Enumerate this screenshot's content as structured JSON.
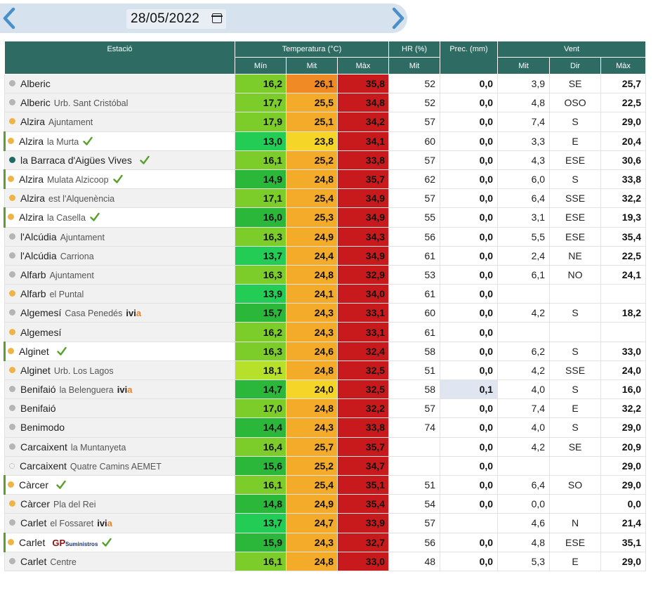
{
  "date": "28/05/2022",
  "colors": {
    "header_bg": "#2e6b63",
    "accent_arrow": "#4a90c8",
    "marker_green": "#5aa02c"
  },
  "headers": {
    "station": "Estació",
    "temperature": "Temperatura (°C)",
    "hr": "HR (%)",
    "prec": "Prec. (mm)",
    "wind": "Vent",
    "t_min": "Mín",
    "t_mit": "Mit",
    "t_max": "Màx",
    "hr_mit": "Mit",
    "w_mit": "Mit",
    "w_dir": "Dir",
    "w_max": "Màx"
  },
  "rows": [
    {
      "name": "Alberic",
      "sub": "",
      "dot": "#b5b5b5",
      "mark": false,
      "check": false,
      "logo": "",
      "tmin": "16,2",
      "tmit": "26,1",
      "tmax": "35,8",
      "cmin": "#7ccc2a",
      "cmit": "#f08a24",
      "cmax": "#c8191c",
      "hr": "52",
      "prec": "0,0",
      "wmit": "3,9",
      "wdir": "SE",
      "wmax": "25,7"
    },
    {
      "name": "Alberic",
      "sub": "Urb. Sant Cristóbal",
      "dot": "#b5b5b5",
      "mark": false,
      "check": false,
      "logo": "",
      "tmin": "17,7",
      "tmit": "25,5",
      "tmax": "34,8",
      "cmin": "#7ccc2a",
      "cmit": "#f5ab2a",
      "cmax": "#c8191c",
      "hr": "52",
      "prec": "0,0",
      "wmit": "4,8",
      "wdir": "OSO",
      "wmax": "22,5"
    },
    {
      "name": "Alzira",
      "sub": "Ajuntament",
      "dot": "#f0b445",
      "mark": false,
      "check": false,
      "logo": "",
      "tmin": "17,9",
      "tmit": "25,1",
      "tmax": "34,2",
      "cmin": "#7ccc2a",
      "cmit": "#f5ab2a",
      "cmax": "#c8191c",
      "hr": "57",
      "prec": "0,0",
      "wmit": "7,4",
      "wdir": "S",
      "wmax": "29,0"
    },
    {
      "name": "Alzira",
      "sub": "la Murta",
      "dot": "#f0b445",
      "mark": true,
      "check": true,
      "logo": "",
      "tmin": "13,0",
      "tmit": "23,8",
      "tmax": "34,1",
      "cmin": "#22cc55",
      "cmit": "#f5d528",
      "cmax": "#c8191c",
      "hr": "60",
      "prec": "0,0",
      "wmit": "3,3",
      "wdir": "E",
      "wmax": "20,4"
    },
    {
      "name": "la Barraca d'Aigües Vives",
      "sub": "",
      "dot": "#1d6b62",
      "mark": false,
      "check": true,
      "logo": "",
      "tmin": "16,1",
      "tmit": "25,2",
      "tmax": "33,8",
      "cmin": "#7ccc2a",
      "cmit": "#f5ab2a",
      "cmax": "#c8191c",
      "hr": "57",
      "prec": "0,0",
      "wmit": "4,3",
      "wdir": "ESE",
      "wmax": "30,6"
    },
    {
      "name": "Alzira",
      "sub": "Mulata Alzicoop",
      "dot": "#f0b445",
      "mark": true,
      "check": true,
      "logo": "",
      "tmin": "14,9",
      "tmit": "24,8",
      "tmax": "35,7",
      "cmin": "#2bb83a",
      "cmit": "#f5ab2a",
      "cmax": "#c8191c",
      "hr": "62",
      "prec": "0,0",
      "wmit": "6,0",
      "wdir": "S",
      "wmax": "33,8"
    },
    {
      "name": "Alzira",
      "sub": "est l'Alquenència",
      "dot": "#f0b445",
      "mark": false,
      "check": false,
      "logo": "",
      "tmin": "17,1",
      "tmit": "25,4",
      "tmax": "34,9",
      "cmin": "#7ccc2a",
      "cmit": "#f5ab2a",
      "cmax": "#c8191c",
      "hr": "57",
      "prec": "0,0",
      "wmit": "6,4",
      "wdir": "SSE",
      "wmax": "32,2"
    },
    {
      "name": "Alzira",
      "sub": "la Casella",
      "dot": "#f0b445",
      "mark": true,
      "check": true,
      "logo": "",
      "tmin": "16,0",
      "tmit": "25,3",
      "tmax": "34,9",
      "cmin": "#2bb83a",
      "cmit": "#f5ab2a",
      "cmax": "#c8191c",
      "hr": "55",
      "prec": "0,0",
      "wmit": "3,1",
      "wdir": "ESE",
      "wmax": "19,3"
    },
    {
      "name": "l'Alcúdia",
      "sub": "Ajuntament",
      "dot": "#b5b5b5",
      "mark": false,
      "check": false,
      "logo": "",
      "tmin": "16,3",
      "tmit": "24,9",
      "tmax": "34,3",
      "cmin": "#7ccc2a",
      "cmit": "#f5ab2a",
      "cmax": "#c8191c",
      "hr": "56",
      "prec": "0,0",
      "wmit": "5,5",
      "wdir": "ESE",
      "wmax": "35,4"
    },
    {
      "name": "l'Alcúdia",
      "sub": "Carriona",
      "dot": "#b5b5b5",
      "mark": false,
      "check": false,
      "logo": "",
      "tmin": "13,7",
      "tmit": "24,4",
      "tmax": "34,9",
      "cmin": "#22cc55",
      "cmit": "#f5ab2a",
      "cmax": "#c8191c",
      "hr": "61",
      "prec": "0,0",
      "wmit": "2,4",
      "wdir": "NE",
      "wmax": "22,5"
    },
    {
      "name": "Alfarb",
      "sub": "Ajuntament",
      "dot": "#b5b5b5",
      "mark": false,
      "check": false,
      "logo": "",
      "tmin": "16,3",
      "tmit": "24,8",
      "tmax": "32,9",
      "cmin": "#7ccc2a",
      "cmit": "#f5ab2a",
      "cmax": "#c8191c",
      "hr": "53",
      "prec": "0,0",
      "wmit": "6,1",
      "wdir": "NO",
      "wmax": "24,1"
    },
    {
      "name": "Alfarb",
      "sub": "el Puntal",
      "dot": "#f0b445",
      "mark": false,
      "check": false,
      "logo": "",
      "tmin": "13,9",
      "tmit": "24,1",
      "tmax": "34,0",
      "cmin": "#22cc55",
      "cmit": "#f5ab2a",
      "cmax": "#c8191c",
      "hr": "61",
      "prec": "0,0",
      "wmit": "",
      "wdir": "",
      "wmax": ""
    },
    {
      "name": "Algemesí",
      "sub": "Casa Penedés",
      "dot": "#b5b5b5",
      "mark": false,
      "check": false,
      "logo": "ivia",
      "tmin": "15,7",
      "tmit": "24,3",
      "tmax": "33,1",
      "cmin": "#2bb83a",
      "cmit": "#f5ab2a",
      "cmax": "#c8191c",
      "hr": "60",
      "prec": "0,0",
      "wmit": "4,2",
      "wdir": "S",
      "wmax": "18,2"
    },
    {
      "name": "Algemesí",
      "sub": "",
      "dot": "#f0b445",
      "mark": false,
      "check": false,
      "logo": "",
      "tmin": "16,2",
      "tmit": "24,3",
      "tmax": "33,1",
      "cmin": "#7ccc2a",
      "cmit": "#f5ab2a",
      "cmax": "#c8191c",
      "hr": "61",
      "prec": "0,0",
      "wmit": "",
      "wdir": "",
      "wmax": ""
    },
    {
      "name": "Alginet",
      "sub": "",
      "dot": "#f0b445",
      "mark": true,
      "check": true,
      "logo": "",
      "tmin": "16,3",
      "tmit": "24,6",
      "tmax": "32,4",
      "cmin": "#7ccc2a",
      "cmit": "#f5ab2a",
      "cmax": "#c8191c",
      "hr": "58",
      "prec": "0,0",
      "wmit": "6,2",
      "wdir": "S",
      "wmax": "33,0"
    },
    {
      "name": "Alginet",
      "sub": "Urb. Los Lagos",
      "dot": "#f0b445",
      "mark": false,
      "check": false,
      "logo": "",
      "tmin": "18,1",
      "tmit": "24,8",
      "tmax": "32,5",
      "cmin": "#b7e02a",
      "cmit": "#f5ab2a",
      "cmax": "#c8191c",
      "hr": "51",
      "prec": "0,0",
      "wmit": "4,2",
      "wdir": "SSE",
      "wmax": "24,0"
    },
    {
      "name": "Benifaió",
      "sub": "la Belenguera",
      "dot": "#b5b5b5",
      "mark": false,
      "check": false,
      "logo": "ivia",
      "tmin": "14,7",
      "tmit": "24,0",
      "tmax": "32,5",
      "cmin": "#2bb83a",
      "cmit": "#f5d528",
      "cmax": "#c8191c",
      "hr": "58",
      "prec": "0,1",
      "wmit": "4,0",
      "wdir": "S",
      "wmax": "16,0"
    },
    {
      "name": "Benifaió",
      "sub": "",
      "dot": "#b5b5b5",
      "mark": false,
      "check": false,
      "logo": "",
      "tmin": "17,0",
      "tmit": "24,8",
      "tmax": "32,2",
      "cmin": "#7ccc2a",
      "cmit": "#f5ab2a",
      "cmax": "#c8191c",
      "hr": "57",
      "prec": "0,0",
      "wmit": "7,4",
      "wdir": "E",
      "wmax": "32,2"
    },
    {
      "name": "Benimodo",
      "sub": "",
      "dot": "#b5b5b5",
      "mark": false,
      "check": false,
      "logo": "",
      "tmin": "14,4",
      "tmit": "24,3",
      "tmax": "33,8",
      "cmin": "#2bb83a",
      "cmit": "#f5ab2a",
      "cmax": "#c8191c",
      "hr": "74",
      "prec": "0,0",
      "wmit": "4,0",
      "wdir": "S",
      "wmax": "29,0"
    },
    {
      "name": "Carcaixent",
      "sub": "la Muntanyeta",
      "dot": "#b5b5b5",
      "mark": false,
      "check": false,
      "logo": "",
      "tmin": "16,4",
      "tmit": "25,7",
      "tmax": "35,7",
      "cmin": "#7ccc2a",
      "cmit": "#f5ab2a",
      "cmax": "#c8191c",
      "hr": "",
      "prec": "0,0",
      "wmit": "4,2",
      "wdir": "SE",
      "wmax": "20,9"
    },
    {
      "name": "Carcaixent",
      "sub": "Quatre Camins AEMET",
      "dot": "hollow",
      "mark": false,
      "check": false,
      "logo": "",
      "tmin": "15,6",
      "tmit": "25,2",
      "tmax": "34,7",
      "cmin": "#2bb83a",
      "cmit": "#f5ab2a",
      "cmax": "#c8191c",
      "hr": "",
      "prec": "0,0",
      "wmit": "",
      "wdir": "",
      "wmax": "29,0"
    },
    {
      "name": "Càrcer",
      "sub": "",
      "dot": "#f0b445",
      "mark": true,
      "check": true,
      "logo": "",
      "tmin": "16,1",
      "tmit": "25,4",
      "tmax": "35,1",
      "cmin": "#7ccc2a",
      "cmit": "#f5ab2a",
      "cmax": "#c8191c",
      "hr": "51",
      "prec": "0,0",
      "wmit": "6,4",
      "wdir": "SO",
      "wmax": "29,0"
    },
    {
      "name": "Càrcer",
      "sub": "Pla del Rei",
      "dot": "#f0b445",
      "mark": false,
      "check": false,
      "logo": "",
      "tmin": "14,8",
      "tmit": "24,9",
      "tmax": "35,4",
      "cmin": "#2bb83a",
      "cmit": "#f5ab2a",
      "cmax": "#c8191c",
      "hr": "54",
      "prec": "0,0",
      "wmit": "0,0",
      "wdir": "",
      "wmax": "0,0"
    },
    {
      "name": "Carlet",
      "sub": "el Fossaret",
      "dot": "#b5b5b5",
      "mark": false,
      "check": false,
      "logo": "ivia",
      "tmin": "13,7",
      "tmit": "24,7",
      "tmax": "33,9",
      "cmin": "#22cc55",
      "cmit": "#f5ab2a",
      "cmax": "#c8191c",
      "hr": "57",
      "prec": "",
      "wmit": "4,6",
      "wdir": "N",
      "wmax": "21,4"
    },
    {
      "name": "Carlet",
      "sub": "",
      "dot": "#f0b445",
      "mark": true,
      "check": true,
      "logo": "gp",
      "tmin": "15,9",
      "tmit": "24,3",
      "tmax": "32,7",
      "cmin": "#2bb83a",
      "cmit": "#f5ab2a",
      "cmax": "#c8191c",
      "hr": "56",
      "prec": "0,0",
      "wmit": "4,8",
      "wdir": "ESE",
      "wmax": "35,1"
    },
    {
      "name": "Carlet",
      "sub": "Centre",
      "dot": "#b5b5b5",
      "mark": false,
      "check": false,
      "logo": "",
      "tmin": "16,1",
      "tmit": "24,8",
      "tmax": "33,0",
      "cmin": "#7ccc2a",
      "cmit": "#f5ab2a",
      "cmax": "#c8191c",
      "hr": "48",
      "prec": "0,0",
      "wmit": "5,3",
      "wdir": "E",
      "wmax": "29,0"
    }
  ]
}
